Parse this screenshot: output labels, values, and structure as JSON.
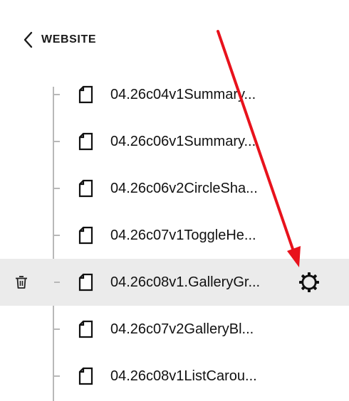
{
  "header": {
    "back_label": "WEBSITE",
    "back_icon": "chevron-left-icon"
  },
  "pages": [
    {
      "title": "04.26c04v1Summary...",
      "selected": false
    },
    {
      "title": "04.26c06v1Summary...",
      "selected": false
    },
    {
      "title": "04.26c06v2CircleSha...",
      "selected": false
    },
    {
      "title": "04.26c07v1ToggleHe...",
      "selected": false
    },
    {
      "title": "04.26c08v1.GalleryGr...",
      "selected": true
    },
    {
      "title": "04.26c07v2GalleryBl...",
      "selected": false
    },
    {
      "title": "04.26c08v1ListCarou...",
      "selected": false
    }
  ],
  "icons": {
    "page": "page-icon",
    "delete": "trash-icon",
    "settings": "gear-icon",
    "annotation": "red-arrow"
  },
  "colors": {
    "selected_row_bg": "#ebebeb",
    "tree_line": "#b8b8b8",
    "annotation_arrow": "#e8121c",
    "text": "#111111"
  }
}
